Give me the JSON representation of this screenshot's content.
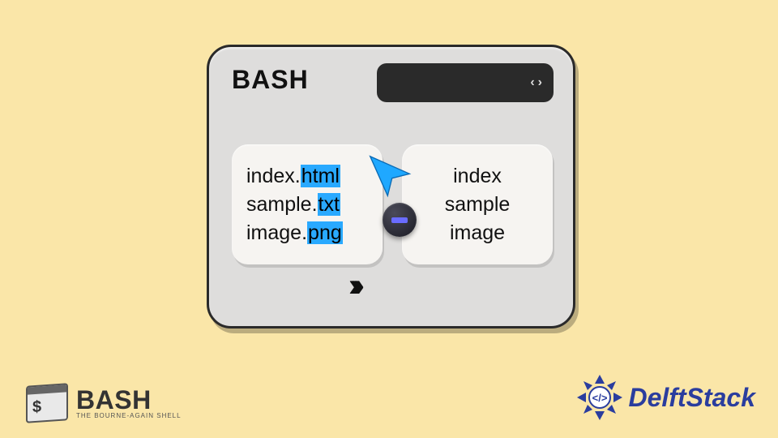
{
  "window": {
    "title": "BASH"
  },
  "left_panel": {
    "lines": [
      {
        "head": "index.",
        "ext": "html"
      },
      {
        "head": "sample.",
        "ext": "txt"
      },
      {
        "head": "image.",
        "ext": "png"
      }
    ]
  },
  "right_panel": {
    "lines": [
      "index",
      "sample",
      "image"
    ]
  },
  "bash_logo": {
    "word": "BASH",
    "tagline": "THE BOURNE-AGAIN SHELL"
  },
  "delft_logo": {
    "word": "DelftStack"
  },
  "glyphs": {
    "chev_left": "‹",
    "chev_right": "›",
    "arrows": "›››"
  }
}
